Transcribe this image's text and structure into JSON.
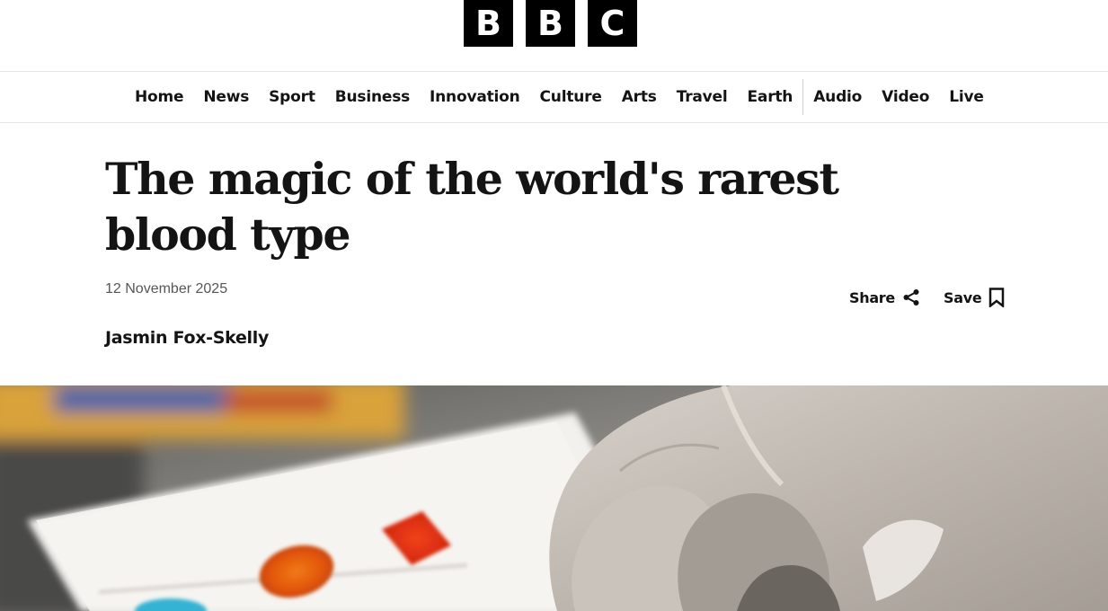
{
  "masthead": {
    "logo_letters": [
      "B",
      "B",
      "C"
    ]
  },
  "nav": {
    "primary": [
      {
        "label": "Home"
      },
      {
        "label": "News"
      },
      {
        "label": "Sport"
      },
      {
        "label": "Business"
      },
      {
        "label": "Innovation"
      },
      {
        "label": "Culture"
      },
      {
        "label": "Arts"
      },
      {
        "label": "Travel"
      },
      {
        "label": "Earth"
      }
    ],
    "secondary": [
      {
        "label": "Audio"
      },
      {
        "label": "Video"
      },
      {
        "label": "Live"
      }
    ]
  },
  "article": {
    "headline": "The magic of the world's rarest blood type",
    "date": "12 November 2025",
    "author": "Jasmin Fox-Skelly",
    "actions": {
      "share_label": "Share",
      "save_label": "Save"
    }
  },
  "hero": {
    "description_icon": "photo"
  },
  "colors": {
    "text": "#141414",
    "muted": "#545658",
    "divider": "#e6e6e6",
    "logo_bg": "#000000"
  }
}
